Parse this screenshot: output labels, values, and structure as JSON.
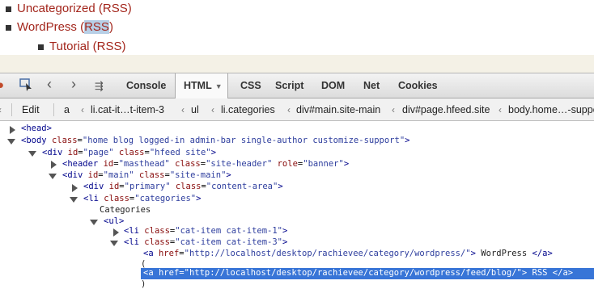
{
  "page": {
    "items": [
      {
        "label": "Uncategorized",
        "rss": "RSS"
      },
      {
        "label": "WordPress",
        "rss": "RSS"
      },
      {
        "label": "Tutorial",
        "rss": "RSS"
      }
    ]
  },
  "firebug": {
    "tabs": [
      "Console",
      "HTML",
      "CSS",
      "Script",
      "DOM",
      "Net",
      "Cookies"
    ],
    "active_tab": "HTML",
    "edit_label": "Edit",
    "breadcrumbs": [
      "a",
      "li.cat-it…t-item-3",
      "ul",
      "li.categories",
      "div#main.site-main",
      "div#page.hfeed.site",
      "body.home…-suppo"
    ]
  },
  "tree": {
    "head": "<head>",
    "body_tag": "<body",
    "body_class": "home blog logged-in admin-bar single-author customize-support",
    "page_id": "page",
    "page_class": "hfeed site",
    "header_id": "masthead",
    "header_class": "site-header",
    "header_role": "banner",
    "main_id": "main",
    "main_class": "site-main",
    "primary_id": "primary",
    "primary_class": "content-area",
    "li_class": "categories",
    "categories_text": "Categories",
    "ul": "<ul>",
    "cat1_class": "cat-item cat-item-1",
    "cat3_class": "cat-item cat-item-3",
    "wp_href": "http://localhost/desktop/rachievee/category/wordpress/",
    "wp_text": "WordPress",
    "paren_open": "(",
    "feed_href": "http://localhost/desktop/rachievee/category/wordpress/feed/blog/",
    "feed_text": "RSS",
    "paren_close": ")"
  }
}
